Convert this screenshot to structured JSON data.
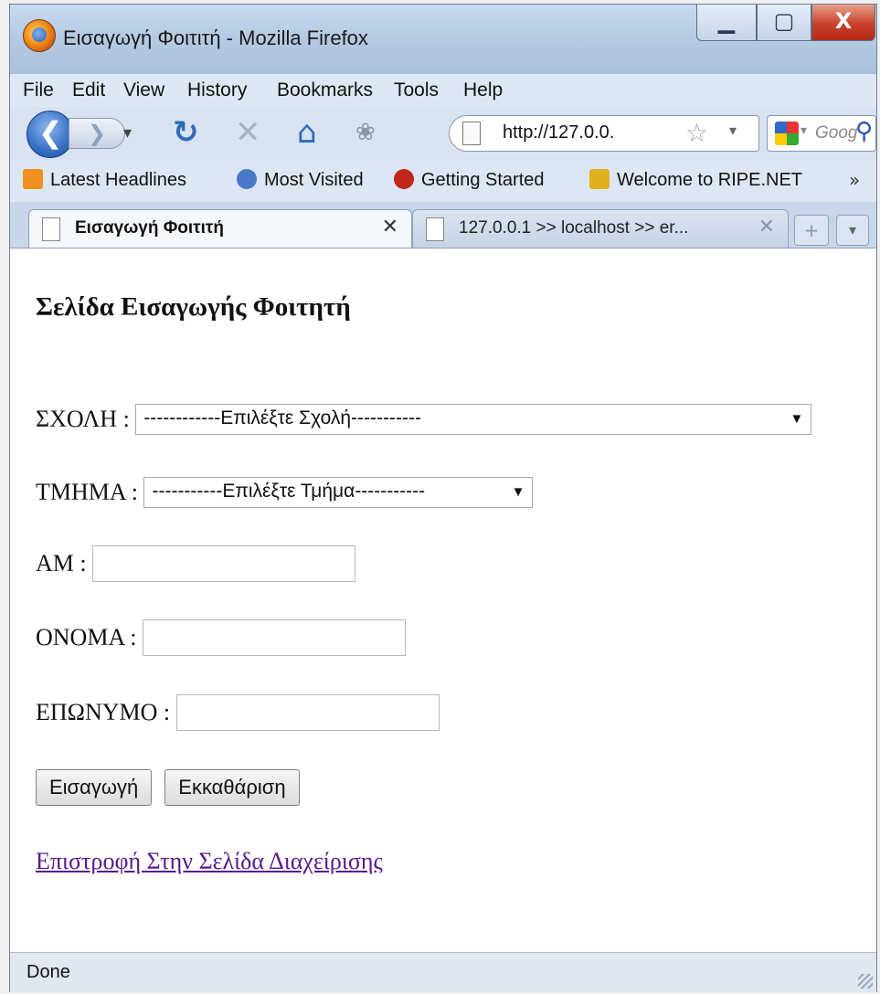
{
  "window": {
    "title": "Εισαγωγή Φοιτιτή - Mozilla Firefox",
    "minimize_glyph": "▁",
    "maximize_glyph": "▢",
    "close_glyph": "X"
  },
  "menu": [
    {
      "label": "File"
    },
    {
      "label": "Edit"
    },
    {
      "label": "View"
    },
    {
      "label": "History"
    },
    {
      "label": "Bookmarks"
    },
    {
      "label": "Tools"
    },
    {
      "label": "Help"
    }
  ],
  "navigation": {
    "back_glyph": "❮",
    "forward_glyph": "❯",
    "dropdown_glyph": "▾",
    "reload_glyph": "↻",
    "stop_glyph": "✕",
    "home_glyph": "⌂",
    "addon_glyph": "❀",
    "url": "http://127.0.0.",
    "star_glyph": "☆",
    "url_dropdown_glyph": "▾",
    "search_placeholder": "Goog",
    "search_glyph": "⚲",
    "search_dropdown_glyph": "▾"
  },
  "bookmarks": [
    {
      "label": "Latest Headlines",
      "icon": "rss-icon",
      "color": "#f0901e"
    },
    {
      "label": "Most Visited",
      "icon": "most-visited-icon",
      "color": "#4a78c8"
    },
    {
      "label": "Getting Started",
      "icon": "firefox-red-icon",
      "color": "#c0261a"
    },
    {
      "label": "Welcome to RIPE.NET",
      "icon": "ripe-icon",
      "color": "#e0b020"
    }
  ],
  "bookmarks_more": "»",
  "tabs": [
    {
      "label": "Εισαγωγή Φοιτιτή",
      "active": true,
      "close": "✕"
    },
    {
      "label": "127.0.0.1 >> localhost >> er...",
      "active": false,
      "close": "✕"
    }
  ],
  "new_tab_glyph": "+",
  "tab_list_glyph": "▾",
  "page": {
    "heading": "Σελίδα Εισαγωγής Φοιτητή",
    "school": {
      "label": "ΣΧΟΛΗ :",
      "selected": "------------Επιλέξτε Σχολή-----------",
      "arrow": "▼"
    },
    "department": {
      "label": "ΤΜΗΜΑ :",
      "selected": "-----------Επιλέξτε Τμήμα-----------",
      "arrow": "▼"
    },
    "am": {
      "label": "ΑΜ :",
      "value": ""
    },
    "name": {
      "label": "ΟΝΟΜΑ :",
      "value": ""
    },
    "surname": {
      "label": "ΕΠΩΝΥΜΟ :",
      "value": ""
    },
    "submit_label": "Εισαγωγή",
    "clear_label": "Εκκαθάριση",
    "back_link": "Επιστροφή Στην Σελίδα Διαχείρισης",
    "visited_link_color": "#551a8b"
  },
  "status": {
    "text": "Done"
  }
}
